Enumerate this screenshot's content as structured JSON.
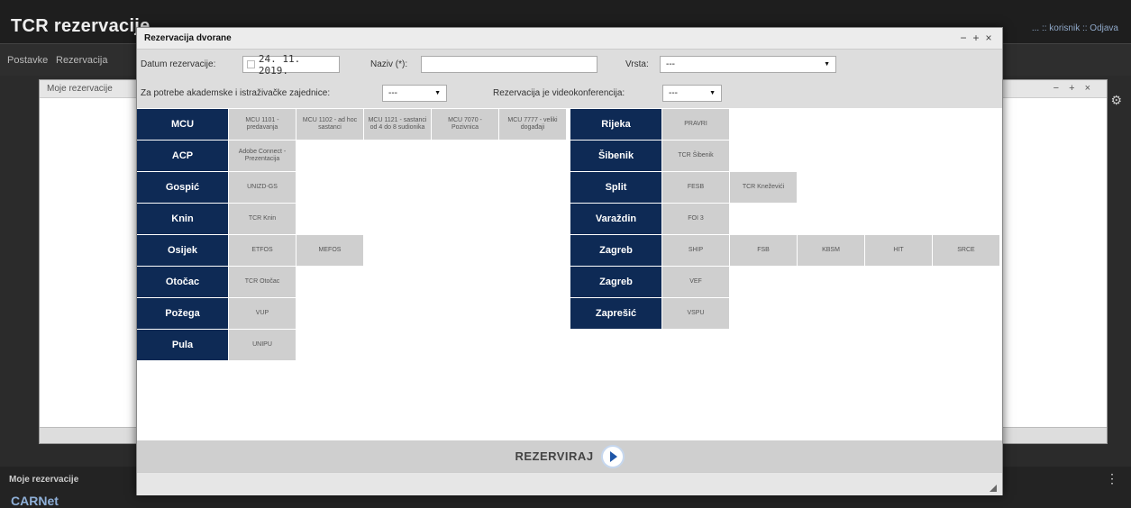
{
  "app": {
    "title": "TCR rezervacije",
    "user_text": "... :: korisnik :: Odjava",
    "menu": [
      "Postavke",
      "Rezervacija"
    ],
    "bg_panel_title": "Moje rezervacije",
    "bottom_label": "Moje rezervacije",
    "footer_logo": "CARNet"
  },
  "modal": {
    "title": "Rezervacija dvorane",
    "controls": [
      "−",
      "+",
      "×"
    ],
    "date_label": "Datum rezervacije:",
    "date_value": "24. 11. 2019.",
    "name_label": "Naziv (*):",
    "name_value": "",
    "type_label": "Vrsta:",
    "type_value": "---",
    "academic_label": "Za potrebe akademske i istraživačke zajednice:",
    "academic_value": "---",
    "video_label": "Rezervacija je videokonferencija:",
    "video_value": "---",
    "reserve_label": "REZERVIRAJ"
  },
  "left_rows": [
    {
      "city": "MCU",
      "rooms": [
        "MCU 1101 - predavanja",
        "MCU 1102 - ad hoc sastanci",
        "MCU 1121 - sastanci od 4 do 8 sudionika",
        "MCU 7070 - Pozivnica",
        "MCU 7777 - veliki događaji"
      ]
    },
    {
      "city": "ACP",
      "rooms": [
        "Adobe Connect - Prezentacija"
      ]
    },
    {
      "city": "Gospić",
      "rooms": [
        "UNIZD-GS"
      ]
    },
    {
      "city": "Knin",
      "rooms": [
        "TCR Knin"
      ]
    },
    {
      "city": "Osijek",
      "rooms": [
        "ETFOS",
        "MEFOS"
      ]
    },
    {
      "city": "Otočac",
      "rooms": [
        "TCR Otočac"
      ]
    },
    {
      "city": "Požega",
      "rooms": [
        "VUP"
      ]
    },
    {
      "city": "Pula",
      "rooms": [
        "UNIPU"
      ]
    }
  ],
  "right_rows": [
    {
      "city": "Rijeka",
      "rooms": [
        "PRAVRI"
      ]
    },
    {
      "city": "Šibenik",
      "rooms": [
        "TCR Šibenik"
      ]
    },
    {
      "city": "Split",
      "rooms": [
        "FESB",
        "TCR Kneževići"
      ]
    },
    {
      "city": "Varaždin",
      "rooms": [
        "FOI 3"
      ]
    },
    {
      "city": "Zagreb",
      "rooms": [
        "SHIP",
        "FSB",
        "KBSM",
        "HIT",
        "SRCE"
      ]
    },
    {
      "city": "Zagreb",
      "rooms": [
        "VEF"
      ]
    },
    {
      "city": "Zaprešić",
      "rooms": [
        "VSPU"
      ]
    }
  ]
}
